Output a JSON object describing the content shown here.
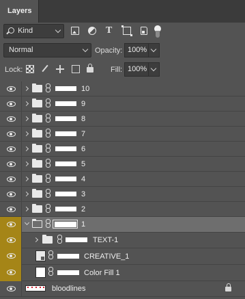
{
  "panel": {
    "tab_title": "Layers"
  },
  "filter": {
    "kind_label": "Kind",
    "icons": [
      "image-filter-icon",
      "adjustment-filter-icon",
      "type-filter-icon",
      "shape-filter-icon",
      "smart-object-filter-icon"
    ]
  },
  "blend": {
    "mode": "Normal",
    "opacity_label": "Opacity:",
    "opacity_value": "100%"
  },
  "lock": {
    "label": "Lock:",
    "fill_label": "Fill:",
    "fill_value": "100%"
  },
  "colors": {
    "highlight": "#a58517",
    "selected_row": "#6e6e6e",
    "panel_bg": "#535353"
  },
  "layers": [
    {
      "name": "10",
      "type": "group",
      "visible": true
    },
    {
      "name": "9",
      "type": "group",
      "visible": true
    },
    {
      "name": "8",
      "type": "group",
      "visible": true
    },
    {
      "name": "7",
      "type": "group",
      "visible": true
    },
    {
      "name": "6",
      "type": "group",
      "visible": true
    },
    {
      "name": "5",
      "type": "group",
      "visible": true
    },
    {
      "name": "4",
      "type": "group",
      "visible": true
    },
    {
      "name": "3",
      "type": "group",
      "visible": true
    },
    {
      "name": "2",
      "type": "group",
      "visible": true
    },
    {
      "name": "1",
      "type": "group",
      "visible": true,
      "expanded": true,
      "selected": true
    },
    {
      "name": "TEXT-1",
      "type": "group",
      "visible": true,
      "child": true
    },
    {
      "name": "CREATIVE_1",
      "type": "smart-object",
      "visible": true,
      "child": true
    },
    {
      "name": "Color Fill 1",
      "type": "fill",
      "visible": true,
      "child": true
    },
    {
      "name": "bloodlines",
      "type": "image",
      "visible": true,
      "locked": true
    }
  ]
}
